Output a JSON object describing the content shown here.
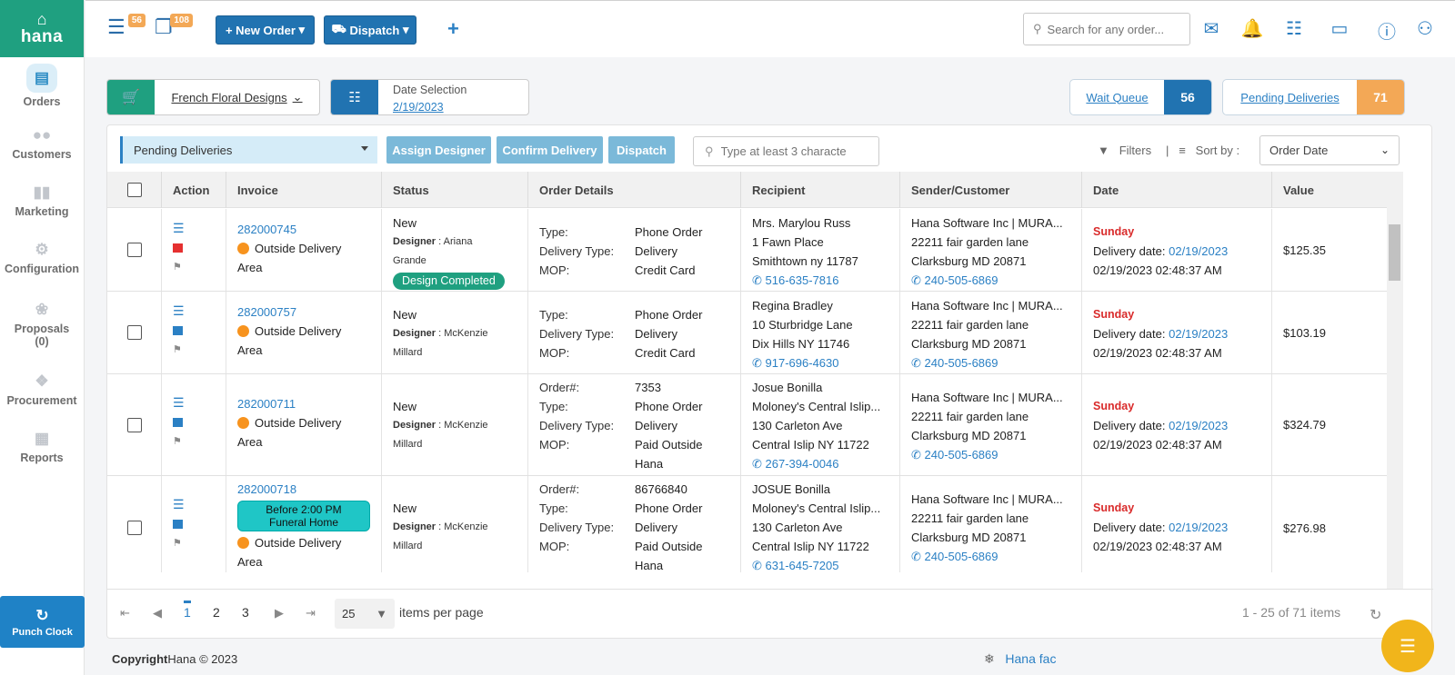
{
  "app": {
    "brand": "hana"
  },
  "sidebar": {
    "items": [
      {
        "label": "Orders",
        "icon": "orders-icon",
        "active": true
      },
      {
        "label": "Customers",
        "icon": "customers-icon"
      },
      {
        "label": "Marketing",
        "icon": "marketing-icon"
      },
      {
        "label": "Configuration",
        "icon": "configuration-icon"
      },
      {
        "label": "Proposals",
        "sub": "(0)",
        "icon": "proposals-icon"
      },
      {
        "label": "Procurement",
        "icon": "procurement-icon"
      },
      {
        "label": "Reports",
        "icon": "reports-icon"
      }
    ],
    "punch_clock": "Punch Clock"
  },
  "topbar": {
    "badge1": "56",
    "badge2": "108",
    "new_order": "New Order",
    "dispatch": "Dispatch",
    "search_placeholder": "Search for any order..."
  },
  "filters": {
    "store": "French Floral Designs",
    "date_label": "Date Selection",
    "date_value": "2/19/2023",
    "wait_queue": "Wait Queue",
    "wait_queue_count": "56",
    "pending_deliveries": "Pending Deliveries",
    "pending_count": "71"
  },
  "toolbar": {
    "view": "Pending Deliveries",
    "assign_designer": "Assign Designer",
    "confirm_delivery": "Confirm Delivery",
    "dispatch": "Dispatch",
    "search_placeholder": "Type at least 3 characte",
    "filters": "Filters",
    "sort_by": "Sort by :",
    "sort_value": "Order Date"
  },
  "table": {
    "headers": [
      "Action",
      "Invoice",
      "Status",
      "Order Details",
      "Recipient",
      "Sender/Customer",
      "Date",
      "Value"
    ],
    "rows": [
      {
        "invoice": "282000745",
        "area1": "Outside Delivery",
        "area2": "Area",
        "status": "New",
        "designer_label": "Designer",
        "designer": "Ariana",
        "designer2": "Grande",
        "pill": "Design Completed",
        "details": [
          [
            "Type:",
            "Phone Order"
          ],
          [
            "Delivery Type:",
            "Delivery"
          ],
          [
            "MOP:",
            "Credit Card"
          ]
        ],
        "recipient": [
          "Mrs. Marylou Russ",
          "1 Fawn Place",
          "Smithtown ny 11787"
        ],
        "recipient_phone": "516-635-7816",
        "sender": [
          "Hana Software Inc | MURA...",
          "22211 fair garden lane",
          "Clarksburg MD 20871"
        ],
        "sender_phone": "240-505-6869",
        "day": "Sunday",
        "delivery_label": "Delivery date:",
        "delivery_date": "02/19/2023",
        "timestamp": "02/19/2023 02:48:37 AM",
        "value": "$125.35"
      },
      {
        "invoice": "282000757",
        "area1": "Outside Delivery",
        "area2": "Area",
        "status": "New",
        "designer_label": "Designer",
        "designer": "McKenzie",
        "designer2": "Millard",
        "details": [
          [
            "Type:",
            "Phone Order"
          ],
          [
            "Delivery Type:",
            "Delivery"
          ],
          [
            "MOP:",
            "Credit Card"
          ]
        ],
        "recipient": [
          "Regina Bradley",
          "10 Sturbridge Lane",
          "Dix Hills NY 11746"
        ],
        "recipient_phone": "917-696-4630",
        "sender": [
          "Hana Software Inc | MURA...",
          "22211 fair garden lane",
          "Clarksburg MD 20871"
        ],
        "sender_phone": "240-505-6869",
        "day": "Sunday",
        "delivery_label": "Delivery date:",
        "delivery_date": "02/19/2023",
        "timestamp": "02/19/2023 02:48:37 AM",
        "value": "$103.19"
      },
      {
        "invoice": "282000711",
        "area1": "Outside Delivery",
        "area2": "Area",
        "status": "New",
        "designer_label": "Designer",
        "designer": "McKenzie",
        "designer2": "Millard",
        "details": [
          [
            "Order#:",
            "7353"
          ],
          [
            "Type:",
            "Phone Order"
          ],
          [
            "Delivery Type:",
            "Delivery"
          ],
          [
            "MOP:",
            "Paid Outside"
          ],
          [
            "",
            "Hana"
          ]
        ],
        "recipient": [
          "Josue Bonilla",
          "Moloney's Central Islip...",
          "130 Carleton Ave",
          "Central Islip NY 11722"
        ],
        "recipient_phone": "267-394-0046",
        "sender": [
          "Hana Software Inc | MURA...",
          "22211 fair garden lane",
          "Clarksburg MD 20871"
        ],
        "sender_phone": "240-505-6869",
        "day": "Sunday",
        "delivery_label": "Delivery date:",
        "delivery_date": "02/19/2023",
        "timestamp": "02/19/2023 02:48:37 AM",
        "value": "$324.79"
      },
      {
        "invoice": "282000718",
        "note1": "Before 2:00 PM",
        "note2": "Funeral Home",
        "area1": "Outside Delivery",
        "area2": "Area",
        "status": "New",
        "designer_label": "Designer",
        "designer": "McKenzie",
        "designer2": "Millard",
        "details": [
          [
            "Order#:",
            "86766840"
          ],
          [
            "Type:",
            "Phone Order"
          ],
          [
            "Delivery Type:",
            "Delivery"
          ],
          [
            "MOP:",
            "Paid Outside"
          ],
          [
            "",
            "Hana"
          ]
        ],
        "recipient": [
          "JOSUE Bonilla",
          "Moloney's Central Islip...",
          "130 Carleton Ave",
          "Central Islip NY 11722"
        ],
        "recipient_phone": "631-645-7205",
        "sender": [
          "Hana Software Inc | MURA...",
          "22211 fair garden lane",
          "Clarksburg MD 20871"
        ],
        "sender_phone": "240-505-6869",
        "day": "Sunday",
        "delivery_label": "Delivery date:",
        "delivery_date": "02/19/2023",
        "timestamp": "02/19/2023 02:48:37 AM",
        "value": "$276.98"
      }
    ]
  },
  "pager": {
    "pages": [
      "1",
      "2",
      "3"
    ],
    "per_page": "25",
    "per_page_label": "items per page",
    "summary": "1 - 25 of 71 items"
  },
  "footer": {
    "copyright": "Copyright",
    "brand": "Hana © 2023",
    "link": "Hana fac"
  },
  "colors": {
    "brand_green": "#1fa080",
    "primary_blue": "#2173b1",
    "accent_orange": "#f3a856"
  }
}
